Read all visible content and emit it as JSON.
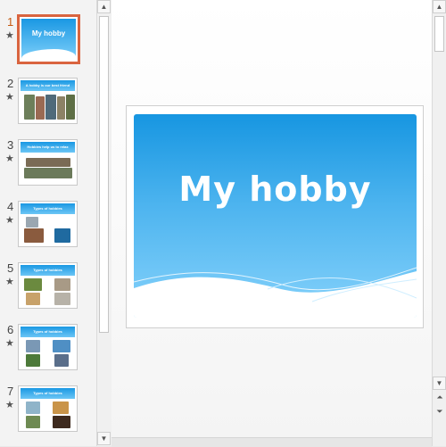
{
  "presentation": {
    "title_slide": {
      "title": "My hobby"
    }
  },
  "thumbnails": [
    {
      "number": "1",
      "title": "My hobby",
      "selected": true,
      "animated": true
    },
    {
      "number": "2",
      "title": "A hobby is our best friend",
      "animated": true
    },
    {
      "number": "3",
      "title": "Hobbies help us to relax",
      "animated": true
    },
    {
      "number": "4",
      "title": "Types of hobbies",
      "animated": true
    },
    {
      "number": "5",
      "title": "Types of hobbies",
      "animated": true
    },
    {
      "number": "6",
      "title": "Types of hobbies",
      "animated": true
    },
    {
      "number": "7",
      "title": "Types of hobbies",
      "animated": true
    }
  ],
  "icons": {
    "animation": "star-icon",
    "scroll_up": "triangle-up-icon",
    "scroll_down": "triangle-down-icon",
    "prev_slide": "double-chevron-up-icon",
    "next_slide": "double-chevron-down-icon"
  },
  "colors": {
    "selection": "#d9643f",
    "slide_blue_top": "#1796e1",
    "slide_blue_bottom": "#86d2fb"
  }
}
